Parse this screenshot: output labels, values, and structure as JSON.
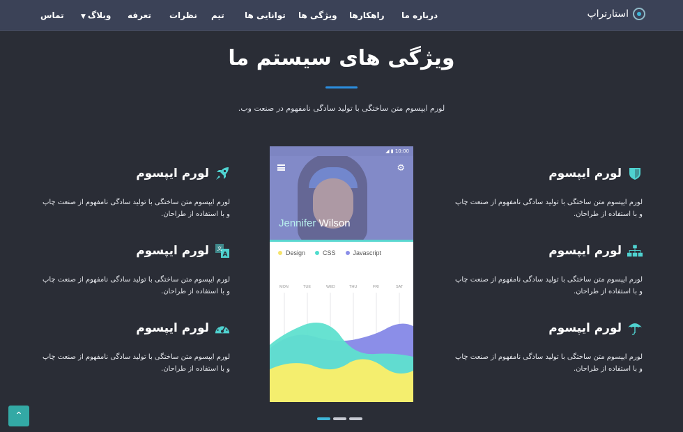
{
  "header": {
    "logo_text": "استارتراپ",
    "nav": [
      "تماس",
      "وبلاگ",
      "تعرفه",
      "نظرات",
      "تیم",
      "توانایی ها",
      "ویژگی ها",
      "راهکارها",
      "درباره ما"
    ]
  },
  "section": {
    "title": "ویژگی های سیستم ما",
    "subtitle": "لورم ایپسوم متن ساختگی با تولید سادگی نامفهوم در صنعت وب."
  },
  "features_right": [
    {
      "title": "لورم ایپسوم",
      "desc": "لورم ایپسوم متن ساختگی با تولید سادگی نامفهوم از صنعت چاپ و با استفاده از طراحان.",
      "icon": "shield-icon"
    },
    {
      "title": "لورم ایپسوم",
      "desc": "لورم ایپسوم متن ساختگی با تولید سادگی نامفهوم از صنعت چاپ و با استفاده از طراحان.",
      "icon": "sitemap-icon"
    },
    {
      "title": "لورم ایپسوم",
      "desc": "لورم ایپسوم متن ساختگی با تولید سادگی نامفهوم از صنعت چاپ و با استفاده از طراحان.",
      "icon": "umbrella-icon"
    }
  ],
  "features_left": [
    {
      "title": "لورم ایپسوم",
      "desc": "لورم ایپسوم متن ساختگی با تولید سادگی نامفهوم از صنعت چاپ و با استفاده از طراحان.",
      "icon": "rocket-icon"
    },
    {
      "title": "لورم ایپسوم",
      "desc": "لورم ایپسوم متن ساختگی با تولید سادگی نامفهوم از صنعت چاپ و با استفاده از طراحان.",
      "icon": "translate-icon"
    },
    {
      "title": "لورم ایپسوم",
      "desc": "لورم ایپسوم متن ساختگی با تولید سادگی نامفهوم از صنعت چاپ و با استفاده از طراحان.",
      "icon": "dashboard-icon"
    }
  ],
  "phone": {
    "time": "10:00",
    "first_name": "Jennifer",
    "last_name": "Wilson",
    "legend": [
      {
        "label": "Design",
        "color": "#f6e36a"
      },
      {
        "label": "CSS",
        "color": "#4fdccd"
      },
      {
        "label": "Javascript",
        "color": "#8b8ee8"
      }
    ],
    "days": [
      "MON",
      "TUE",
      "WED",
      "THU",
      "FRI",
      "SAT"
    ]
  },
  "colors": {
    "accent": "#2b8ee0",
    "teal": "#4fd2d0",
    "background": "#2a2d36",
    "header": "#3b4257"
  },
  "carousel": {
    "count": 3,
    "active": 0
  },
  "back_to_top_icon": "chevron-up-icon"
}
